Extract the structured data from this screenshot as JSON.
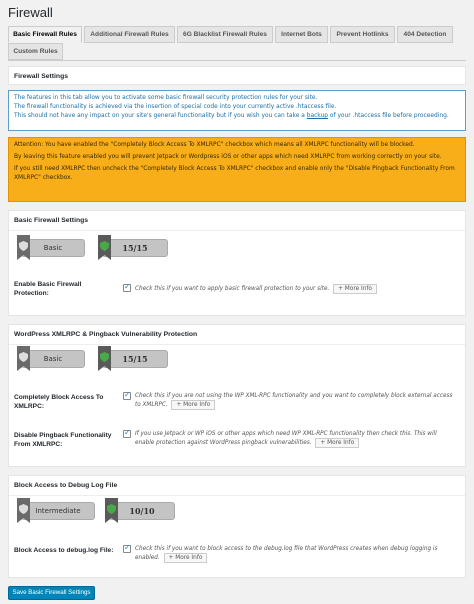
{
  "page": {
    "title": "Firewall"
  },
  "tabs": [
    {
      "label": "Basic Firewall Rules",
      "active": true
    },
    {
      "label": "Additional Firewall Rules"
    },
    {
      "label": "6G Blacklist Firewall Rules"
    },
    {
      "label": "Internet Bots"
    },
    {
      "label": "Prevent Hotlinks"
    },
    {
      "label": "404 Detection"
    },
    {
      "label": "Custom Rules"
    }
  ],
  "firewall_settings": {
    "title": "Firewall Settings"
  },
  "info_box": {
    "line1": "The features in this tab allow you to activate some basic firewall security protection rules for your site.",
    "line2": "The firewall functionality is achieved via the insertion of special code into your currently active .htaccess file.",
    "line3_pre": "This should not have any impact on your site's general functionality but if you wish you can take a ",
    "line3_link": "backup",
    "line3_post": " of your .htaccess file before proceeding."
  },
  "warning_box": {
    "p1": "Attention: You have enabled the \"Completely Block Access To XMLRPC\" checkbox which means all XMLRPC functionality will be blocked.",
    "p2": "By leaving this feature enabled you will prevent Jetpack or Wordpress iOS or other apps which need XMLRPC from working correctly on your site.",
    "p3": "If you still need XMLRPC then uncheck the \"Completely Block Access To XMLRPC\" checkbox and enable only the \"Disable Pingback Functionality From XMLRPC\" checkbox."
  },
  "basic_section": {
    "title": "Basic Firewall Settings",
    "level": "Basic",
    "score": "15/15",
    "label": "Enable Basic Firewall Protection:",
    "desc": "Check this if you want to apply basic firewall protection to your site.",
    "more": "More Info",
    "checked": true
  },
  "xmlrpc_section": {
    "title": "WordPress XMLRPC & Pingback Vulnerability Protection",
    "level": "Basic",
    "score": "15/15",
    "row1_label": "Completely Block Access To XMLRPC:",
    "row1_desc": "Check this if you are not using the WP XML-RPC functionality and you want to completely block external access to XMLRPC.",
    "row1_checked": true,
    "row2_label": "Disable Pingback Functionality From XMLRPC:",
    "row2_desc": "If you use Jetpack or WP iOS or other apps which need WP XML-RPC functionality then check this. This will enable protection against WordPress pingback vulnerabilities.",
    "row2_checked": true,
    "more": "More Info"
  },
  "debug_section": {
    "title": "Block Access to Debug Log File",
    "level": "Intermediate",
    "score": "10/10",
    "label": "Block Access to debug.log File:",
    "desc": "Check this if you want to block access to the debug.log file that WordPress creates when debug logging is enabled.",
    "more": "More Info",
    "checked": true
  },
  "save_button": {
    "label": "Save Basic Firewall Settings"
  },
  "colors": {
    "accent": "#0085ba",
    "warning": "#f7ae18",
    "info_border": "#5aa0cc"
  }
}
